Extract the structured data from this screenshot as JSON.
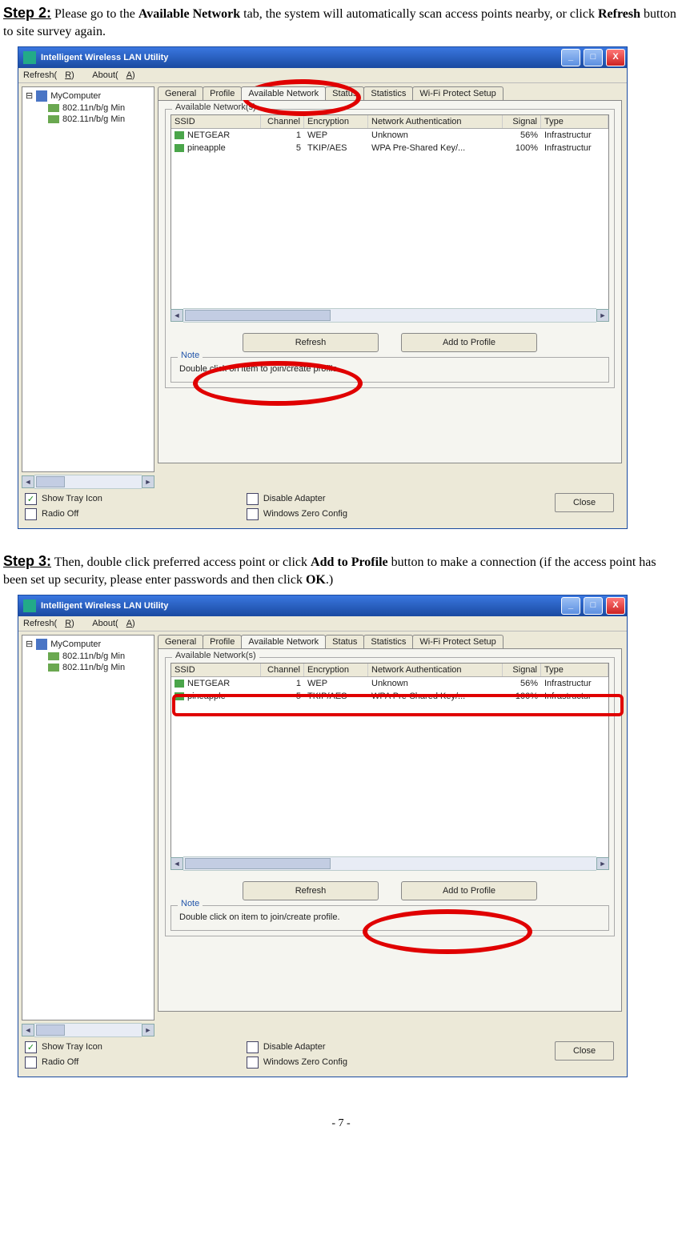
{
  "doc": {
    "step2_label": "Step 2:",
    "step2_text_a": " Please go to the ",
    "step2_bold_a": "Available Network",
    "step2_text_b": " tab, the system will automatically scan access points nearby, or click ",
    "step2_bold_b": "Refresh",
    "step2_text_c": " button to site survey again.",
    "step3_label": "Step 3:",
    "step3_text_a": " Then, double click preferred access point or click ",
    "step3_bold_a": "Add to Profile",
    "step3_text_b": " button to make a connection (if the access point has been set up security, please enter passwords and then click ",
    "step3_bold_b": "OK",
    "step3_text_c": ".)",
    "page_num": "- 7 -"
  },
  "app": {
    "title": "Intelligent Wireless LAN Utility",
    "menu": {
      "refresh": "Refresh(",
      "refresh_u": "R",
      "refresh_end": ")",
      "about": "About(",
      "about_u": "A",
      "about_end": ")"
    },
    "tree": {
      "root": "MyComputer",
      "items": [
        "802.11n/b/g Min",
        "802.11n/b/g Min"
      ]
    },
    "tabs": [
      "General",
      "Profile",
      "Available Network",
      "Status",
      "Statistics",
      "Wi-Fi Protect Setup"
    ],
    "group_label": "Available Network(s)",
    "columns": {
      "ssid": "SSID",
      "channel": "Channel",
      "enc": "Encryption",
      "auth": "Network Authentication",
      "signal": "Signal",
      "type": "Type"
    },
    "rows": [
      {
        "ssid": "NETGEAR",
        "channel": "1",
        "enc": "WEP",
        "auth": "Unknown",
        "signal": "56%",
        "type": "Infrastructur",
        "icon": "wep"
      },
      {
        "ssid": "pineapple",
        "channel": "5",
        "enc": "TKIP/AES",
        "auth": "WPA Pre-Shared Key/...",
        "signal": "100%",
        "type": "Infrastructur",
        "icon": "wpa"
      }
    ],
    "buttons": {
      "refresh": "Refresh",
      "add": "Add to Profile",
      "close": "Close"
    },
    "note_label": "Note",
    "note_text": "Double click on item to join/create profile.",
    "checks": {
      "tray": "Show Tray Icon",
      "radio": "Radio Off",
      "disable": "Disable Adapter",
      "wzc": "Windows Zero Config"
    }
  }
}
